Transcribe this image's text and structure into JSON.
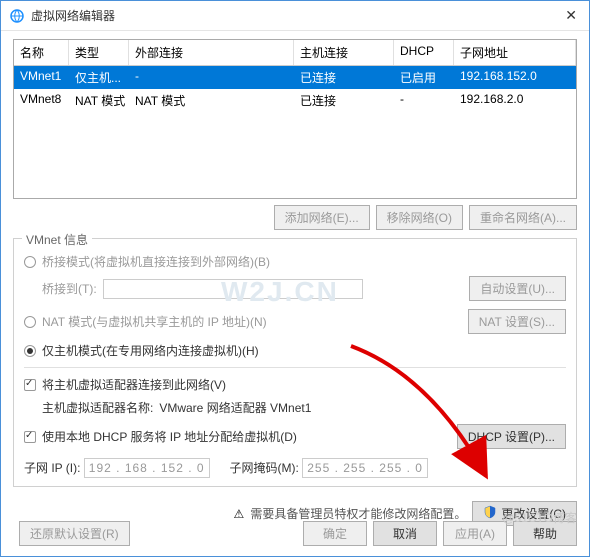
{
  "window": {
    "title": "虚拟网络编辑器"
  },
  "table": {
    "headers": [
      "名称",
      "类型",
      "外部连接",
      "主机连接",
      "DHCP",
      "子网地址"
    ],
    "rows": [
      {
        "c": [
          "VMnet1",
          "仅主机...",
          "-",
          "已连接",
          "已启用",
          "192.168.152.0"
        ],
        "sel": true
      },
      {
        "c": [
          "VMnet8",
          "NAT 模式",
          "NAT 模式",
          "已连接",
          "-",
          "192.168.2.0"
        ],
        "sel": false
      }
    ]
  },
  "buttons": {
    "add": "添加网络(E)...",
    "remove": "移除网络(O)",
    "rename": "重命名网络(A)..."
  },
  "fieldset": {
    "legend": "VMnet 信息",
    "bridge": "桥接模式(将虚拟机直接连接到外部网络)(B)",
    "bridge_to": "桥接到(T):",
    "auto_set": "自动设置(U)...",
    "nat": "NAT 模式(与虚拟机共享主机的 IP 地址)(N)",
    "nat_set": "NAT 设置(S)...",
    "host": "仅主机模式(在专用网络内连接虚拟机)(H)",
    "conn": "将主机虚拟适配器连接到此网络(V)",
    "adapter_lbl": "主机虚拟适配器名称:",
    "adapter_val": "VMware 网络适配器 VMnet1",
    "dhcp": "使用本地 DHCP 服务将 IP 地址分配给虚拟机(D)",
    "dhcp_set": "DHCP 设置(P)...",
    "subnet_ip_lbl": "子网 IP (I):",
    "subnet_ip": "192 . 168 . 152 .  0",
    "mask_lbl": "子网掩码(M):",
    "mask": "255 . 255 . 255 .  0"
  },
  "admin": {
    "warn": "需要具备管理员特权才能修改网络配置。",
    "change": "更改设置(C)"
  },
  "footer": {
    "restore": "还原默认设置(R)",
    "ok": "确定",
    "cancel": "取消",
    "apply": "应用(A)",
    "help": "帮助"
  },
  "watermark": "@51CTO博客",
  "wm2": "W2J.CN"
}
